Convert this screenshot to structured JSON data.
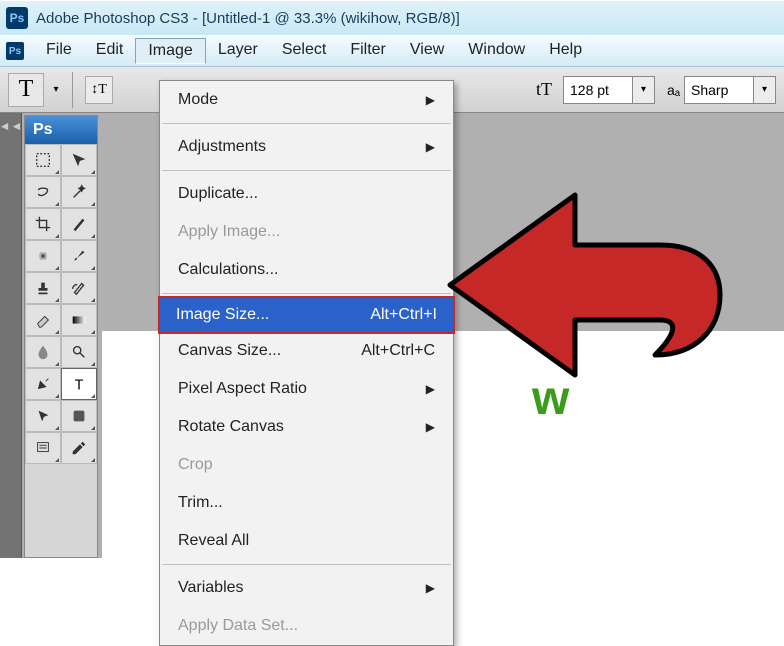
{
  "titlebar": {
    "app_name": "Adobe Photoshop CS3",
    "doc": "[Untitled-1 @ 33.3% (wikihow, RGB/8)]",
    "logo": "Ps"
  },
  "menubar": {
    "items": [
      "File",
      "Edit",
      "Image",
      "Layer",
      "Select",
      "Filter",
      "View",
      "Window",
      "Help"
    ],
    "open_index": 2
  },
  "optionsbar": {
    "tool_letter": "T",
    "orient": "↕T",
    "tt_icon": "tT",
    "font_size": "128 pt",
    "aa_label": "aₐ",
    "aa_value": "Sharp"
  },
  "toolbox": {
    "header": "Ps",
    "tools": [
      {
        "name": "marquee",
        "active": false
      },
      {
        "name": "move",
        "active": false
      },
      {
        "name": "lasso",
        "active": false
      },
      {
        "name": "wand",
        "active": false
      },
      {
        "name": "crop",
        "active": false
      },
      {
        "name": "slice",
        "active": false
      },
      {
        "name": "heal",
        "active": false
      },
      {
        "name": "brush",
        "active": false
      },
      {
        "name": "stamp",
        "active": false
      },
      {
        "name": "history-brush",
        "active": false
      },
      {
        "name": "eraser",
        "active": false
      },
      {
        "name": "gradient",
        "active": false
      },
      {
        "name": "blur",
        "active": false
      },
      {
        "name": "dodge",
        "active": false
      },
      {
        "name": "pen",
        "active": false
      },
      {
        "name": "type",
        "active": true
      },
      {
        "name": "path-select",
        "active": false
      },
      {
        "name": "shape",
        "active": false
      },
      {
        "name": "notes",
        "active": false
      },
      {
        "name": "eyedropper",
        "active": false
      }
    ]
  },
  "dropdown": {
    "items": [
      {
        "label": "Mode",
        "type": "submenu"
      },
      {
        "type": "sep"
      },
      {
        "label": "Adjustments",
        "type": "submenu"
      },
      {
        "type": "sep"
      },
      {
        "label": "Duplicate...",
        "type": "item"
      },
      {
        "label": "Apply Image...",
        "type": "item",
        "disabled": true
      },
      {
        "label": "Calculations...",
        "type": "item"
      },
      {
        "type": "sep"
      },
      {
        "label": "Image Size...",
        "shortcut": "Alt+Ctrl+I",
        "type": "item",
        "highlighted": true
      },
      {
        "label": "Canvas Size...",
        "shortcut": "Alt+Ctrl+C",
        "type": "item"
      },
      {
        "label": "Pixel Aspect Ratio",
        "type": "submenu"
      },
      {
        "label": "Rotate Canvas",
        "type": "submenu"
      },
      {
        "label": "Crop",
        "type": "item",
        "disabled": true
      },
      {
        "label": "Trim...",
        "type": "item"
      },
      {
        "label": "Reveal All",
        "type": "item"
      },
      {
        "type": "sep"
      },
      {
        "label": "Variables",
        "type": "submenu"
      },
      {
        "label": "Apply Data Set...",
        "type": "item",
        "disabled": true
      }
    ]
  },
  "canvas": {
    "visible_text": "w"
  },
  "annotation": {
    "arrow_color": "#c62828"
  }
}
